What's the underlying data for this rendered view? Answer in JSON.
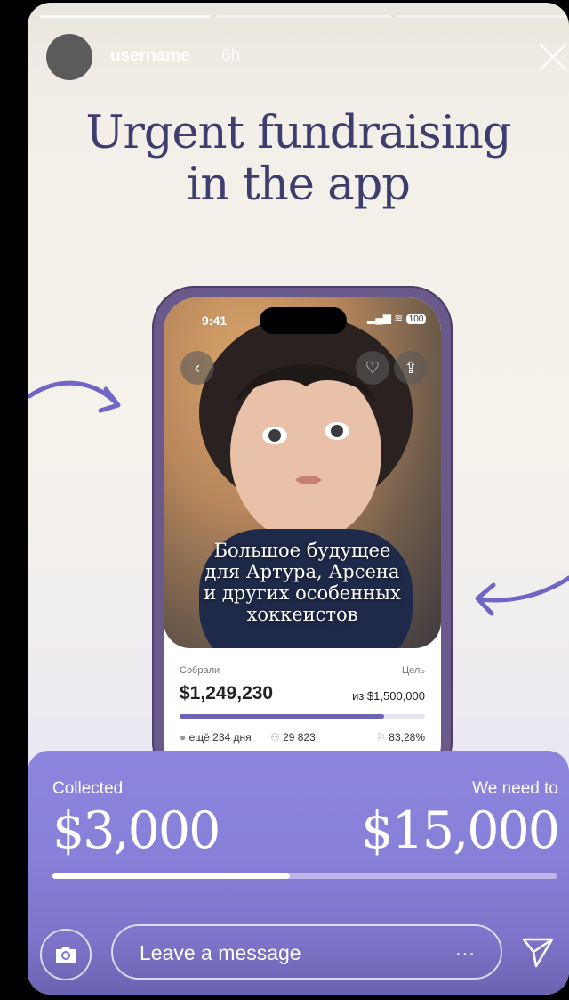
{
  "story": {
    "username": "username",
    "time": "6h",
    "progress_segments": 3
  },
  "headline": {
    "line1": "Urgent fundraising",
    "line2": "in the app"
  },
  "phone": {
    "status_time": "9:41",
    "battery": "100",
    "title_lines": [
      "Большое будущее",
      "для Артура, Арсена",
      "и других особенных",
      "хоккеистов"
    ],
    "collected_label": "Собрали",
    "goal_label": "Цель",
    "collected_amount": "$1,249,230",
    "goal_amount": "из $1,500,000",
    "days_left": "ещё 234 дня",
    "donors": "29 823",
    "percent": "83,28%",
    "progress_fraction": 0.8328
  },
  "fundraising": {
    "collected_label": "Collected",
    "need_label": "We need to",
    "collected_value": "$3,000",
    "need_value": "$15,000",
    "progress_fraction": 0.47
  },
  "reply": {
    "placeholder": "Leave a message",
    "more": "..."
  },
  "colors": {
    "accent": "#8780d8",
    "headline": "#3f3d6e",
    "arrow": "#6e65c4"
  }
}
